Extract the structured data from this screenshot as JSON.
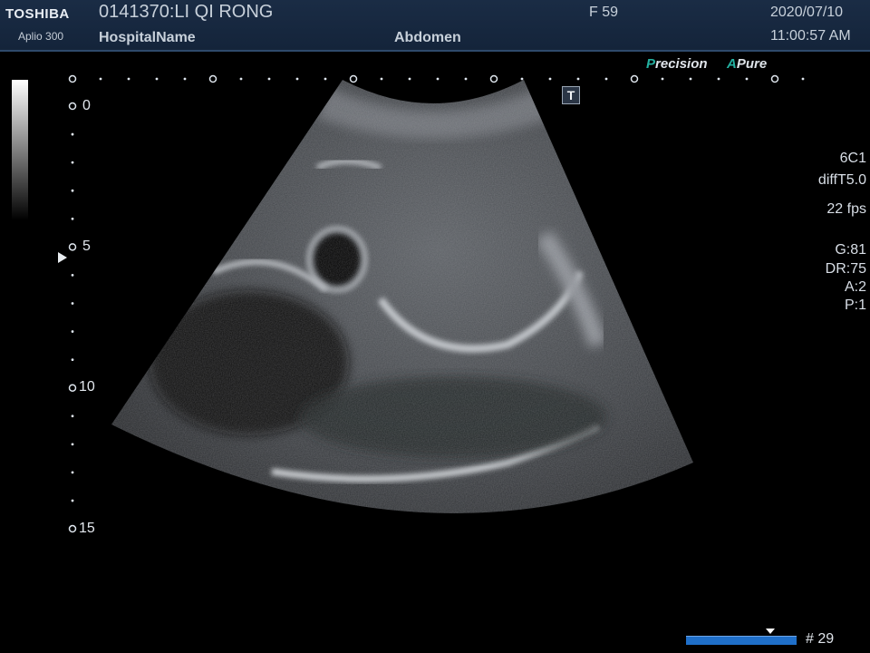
{
  "header": {
    "brand": "TOSHIBA",
    "model": "Aplio 300",
    "patient": "0141370:LI QI RONG",
    "hospital": "HospitalName",
    "preset": "Abdomen",
    "frame_label": "F  59",
    "date": "2020/07/10",
    "time": "11:00:57 AM"
  },
  "badges": {
    "precision_lead": "P",
    "precision_rest": "recision",
    "apure_lead": "A",
    "apure_rest": "Pure"
  },
  "marker": {
    "label": "T"
  },
  "depth_scale": {
    "labels": [
      "0",
      "5",
      "10",
      "15"
    ]
  },
  "params": {
    "probe": "6C1",
    "mode": "diffT5.0",
    "fps": "22 fps",
    "gain": "G:81",
    "dynamic_range": "DR:75",
    "a": "A:2",
    "p": "P:1"
  },
  "cine": {
    "frame_count": "# 29"
  },
  "colors": {
    "header_bg": "#1a2c45",
    "accent_teal": "#23b0a0",
    "cine_blue": "#1f6fc9"
  },
  "icons": [
    "t-marker-icon",
    "focus-pointer-icon",
    "cine-thumb-icon"
  ]
}
